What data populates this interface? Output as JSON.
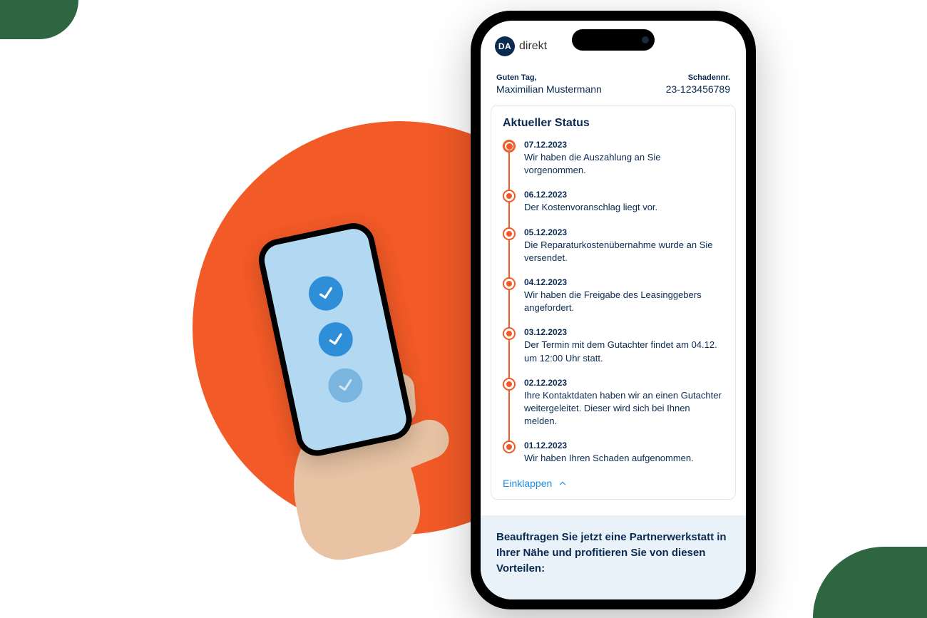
{
  "brand": {
    "logo_badge": "DA",
    "logo_text": "direkt"
  },
  "greeting": {
    "label": "Guten Tag,",
    "user_name": "Maximilian Mustermann"
  },
  "claim": {
    "label": "Schadennr.",
    "number": "23-123456789"
  },
  "status": {
    "title": "Aktueller Status",
    "collapse_label": "Einklappen",
    "items": [
      {
        "date": "07.12.2023",
        "text": "Wir haben die Auszahlung an Sie vorgenommen."
      },
      {
        "date": "06.12.2023",
        "text": "Der Kostenvoranschlag liegt vor."
      },
      {
        "date": "05.12.2023",
        "text": "Die Reparaturkostenübernahme wurde an Sie versendet."
      },
      {
        "date": "04.12.2023",
        "text": "Wir haben die Freigabe des Leasinggebers angefordert."
      },
      {
        "date": "03.12.2023",
        "text": "Der Termin mit dem Gutachter findet am 04.12. um 12:00 Uhr statt."
      },
      {
        "date": "02.12.2023",
        "text": "Ihre Kontaktdaten haben wir an einen Gutachter weitergeleitet. Dieser wird sich bei Ihnen melden."
      },
      {
        "date": "01.12.2023",
        "text": "Wir haben Ihren Schaden aufgenommen."
      }
    ]
  },
  "promo_text": "Beauftragen Sie jetzt eine Partnerwerkstatt in Ihrer Nähe und profitieren Sie von diesen Vorteilen:",
  "colors": {
    "accent_orange": "#f25a27",
    "brand_navy": "#0a2a52",
    "link_blue": "#1b8ee6",
    "decor_green": "#2d6640"
  }
}
